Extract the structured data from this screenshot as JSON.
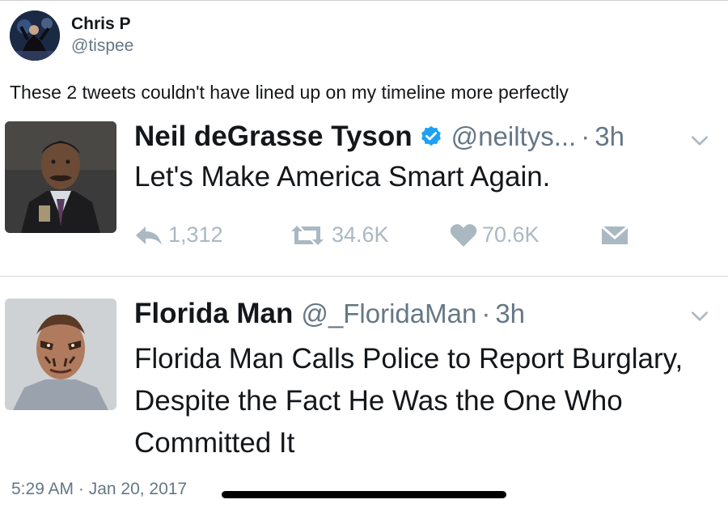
{
  "author": {
    "name": "Chris P",
    "handle": "@tispee"
  },
  "caption": "These 2 tweets couldn't have lined up on my timeline more perfectly",
  "embedded_tweets": [
    {
      "name": "Neil deGrasse Tyson",
      "verified": true,
      "handle": "@neiltys...",
      "separator": "·",
      "time": "3h",
      "text": "Let's Make America Smart Again.",
      "replies": "1,312",
      "retweets": "34.6K",
      "likes": "70.6K"
    },
    {
      "name": "Florida Man",
      "verified": false,
      "handle": "@_FloridaMan",
      "separator": "·",
      "time": "3h",
      "text": "Florida Man Calls Police to Report Burglary, Despite the Fact He Was the One Who Committed It"
    }
  ],
  "footer": {
    "timestamp": "5:29 AM · Jan 20, 2017"
  },
  "colors": {
    "text": "#14171a",
    "secondary": "#657786",
    "action_gray": "#aab8c2",
    "verified_blue": "#1da1f2"
  },
  "icons": [
    "verified-badge-icon",
    "chevron-down-icon",
    "reply-icon",
    "retweet-icon",
    "heart-icon",
    "direct-message-icon"
  ]
}
